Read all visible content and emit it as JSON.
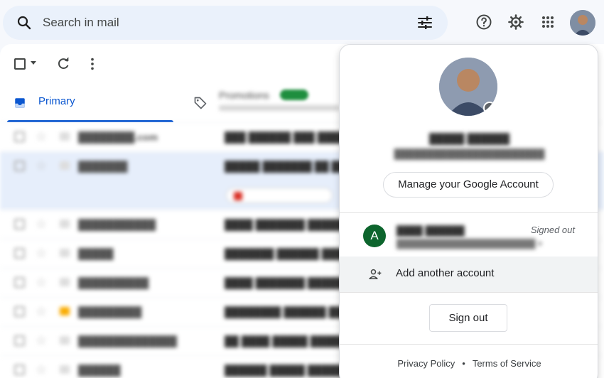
{
  "search": {
    "placeholder": "Search in mail"
  },
  "toolbar": {
    "refresh_icon": "refresh-icon",
    "more_icon": "more-vert-icon"
  },
  "tabs": [
    {
      "label": "Primary",
      "icon": "inbox-icon",
      "active": true
    },
    {
      "label": "Promotions",
      "icon": "tag-icon",
      "active": false
    }
  ],
  "topbar_icons": [
    "help-icon",
    "gear-icon",
    "apps-icon"
  ],
  "account_panel": {
    "manage_label": "Manage your Google Account",
    "other_account": {
      "initial": "A",
      "status": "Signed out"
    },
    "add_account_label": "Add another account",
    "sign_out_label": "Sign out",
    "footer": {
      "privacy": "Privacy Policy",
      "separator": "•",
      "terms": "Terms of Service"
    }
  },
  "colors": {
    "accent": "#0b57d0",
    "avatar_green": "#0d652d"
  }
}
